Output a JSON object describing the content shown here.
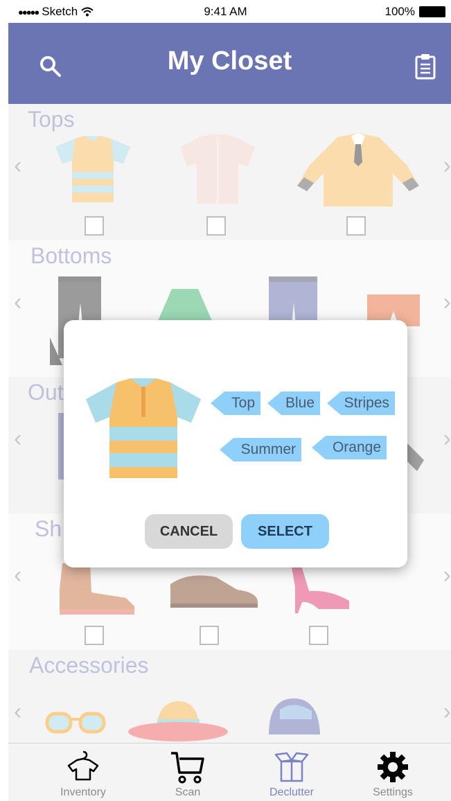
{
  "status_bar": {
    "carrier": "Sketch",
    "time": "9:41 AM",
    "battery": "100%"
  },
  "navbar": {
    "title": "My Closet"
  },
  "sections": {
    "tops": {
      "title": "Tops"
    },
    "bottoms": {
      "title": "Bottoms"
    },
    "outerwear": {
      "title": "Out"
    },
    "shoes": {
      "title": "Sh"
    },
    "accessories": {
      "title": "Accessories"
    }
  },
  "modal": {
    "tags": [
      "Top",
      "Blue",
      "Stripes",
      "Summer",
      "Orange"
    ],
    "cancel_label": "CANCEL",
    "select_label": "SELECT"
  },
  "tabbar": {
    "items": [
      {
        "label": "Inventory",
        "icon": "shirt-hanger-icon"
      },
      {
        "label": "Scan",
        "icon": "cart-icon"
      },
      {
        "label": "Declutter",
        "icon": "box-icon"
      },
      {
        "label": "Settings",
        "icon": "gear-icon"
      }
    ],
    "active_index": 2,
    "active_color": "#7b83c2"
  },
  "colors": {
    "navbar": "#6c75b3",
    "accent_blue": "#8fd0fb",
    "section_title": "#8a8fc2"
  }
}
